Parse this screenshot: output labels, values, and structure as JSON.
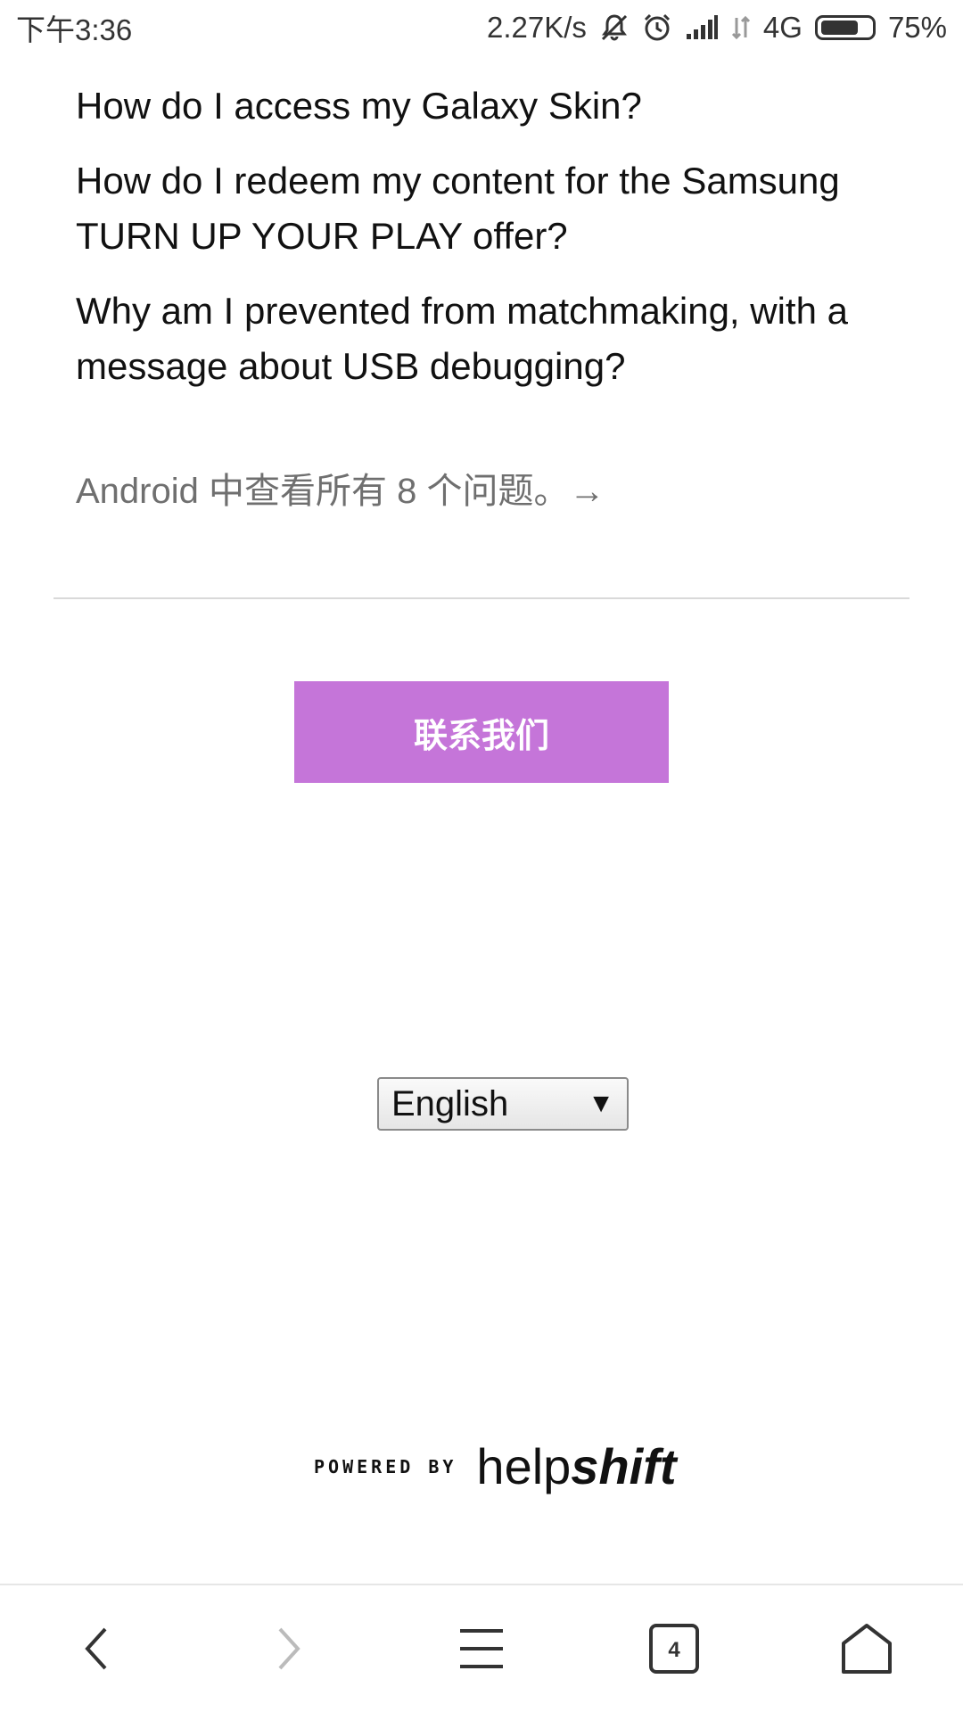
{
  "status_bar": {
    "time": "下午3:36",
    "net_speed": "2.27K/s",
    "network_type": "4G",
    "battery": "75%",
    "battery_level": 0.75,
    "icons": [
      "mute-icon",
      "alarm-icon",
      "signal-icon",
      "data-arrows-icon",
      "battery-icon"
    ]
  },
  "faq": {
    "items": [
      {
        "title": "How do I access my Galaxy Skin?"
      },
      {
        "title": "How do I redeem my content for the Samsung TURN UP YOUR PLAY offer?"
      },
      {
        "title": "Why am I prevented from matchmaking, with a message about USB debugging?"
      }
    ],
    "view_all": "Android 中查看所有 8 个问题。→"
  },
  "contact": {
    "label": "联系我们",
    "color": "#c575d9"
  },
  "language": {
    "selected": "English",
    "arrow": "▼"
  },
  "footer": {
    "powered_by": "POWERED BY",
    "brand_part1": "help",
    "brand_part2": "shift"
  },
  "browser_nav": {
    "tab_count": "4",
    "buttons": [
      "back-icon",
      "forward-icon",
      "menu-icon",
      "tabs-icon",
      "home-icon"
    ]
  }
}
